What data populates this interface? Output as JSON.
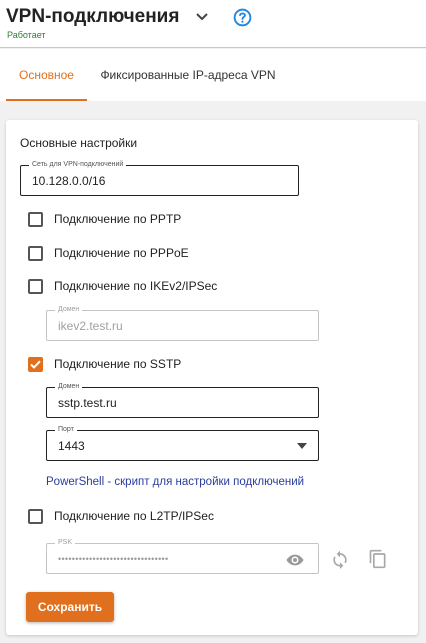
{
  "header": {
    "title": "VPN-подключения",
    "status": "Работает",
    "chevron_icon": "chevron-down-icon",
    "help_icon": "help-circle-icon"
  },
  "tabs": [
    {
      "label": "Основное",
      "active": true
    },
    {
      "label": "Фиксированные IP-адреса VPN",
      "active": false
    }
  ],
  "settings": {
    "section_title": "Основные настройки",
    "network": {
      "label": "Сеть для VPN-подключений",
      "value": "10.128.0.0/16"
    },
    "pptp": {
      "label": "Подключение по PPTP",
      "checked": false
    },
    "pppoe": {
      "label": "Подключение по PPPoE",
      "checked": false
    },
    "ikev2": {
      "label": "Подключение по IKEv2/IPSec",
      "checked": false,
      "domain_label": "Домен",
      "domain_value": "ikev2.test.ru"
    },
    "sstp": {
      "label": "Подключение по SSTP",
      "checked": true,
      "domain_label": "Домен",
      "domain_value": "sstp.test.ru",
      "port_label": "Порт",
      "port_value": "1443"
    },
    "powershell_link": "PowerShell - скрипт для настройки подключений",
    "l2tp": {
      "label": "Подключение по L2TP/IPSec",
      "checked": false,
      "psk_label": "PSK",
      "psk_value": "••••••••••••••••••••••••••••••••"
    },
    "icons": {
      "show_psk": "eye-icon",
      "regenerate": "refresh-icon",
      "copy": "copy-icon"
    }
  },
  "actions": {
    "save_label": "Сохранить"
  },
  "colors": {
    "accent": "#e0701d",
    "link": "#2b3c9e",
    "status": "#2e7d32",
    "help": "#1e88e5"
  }
}
